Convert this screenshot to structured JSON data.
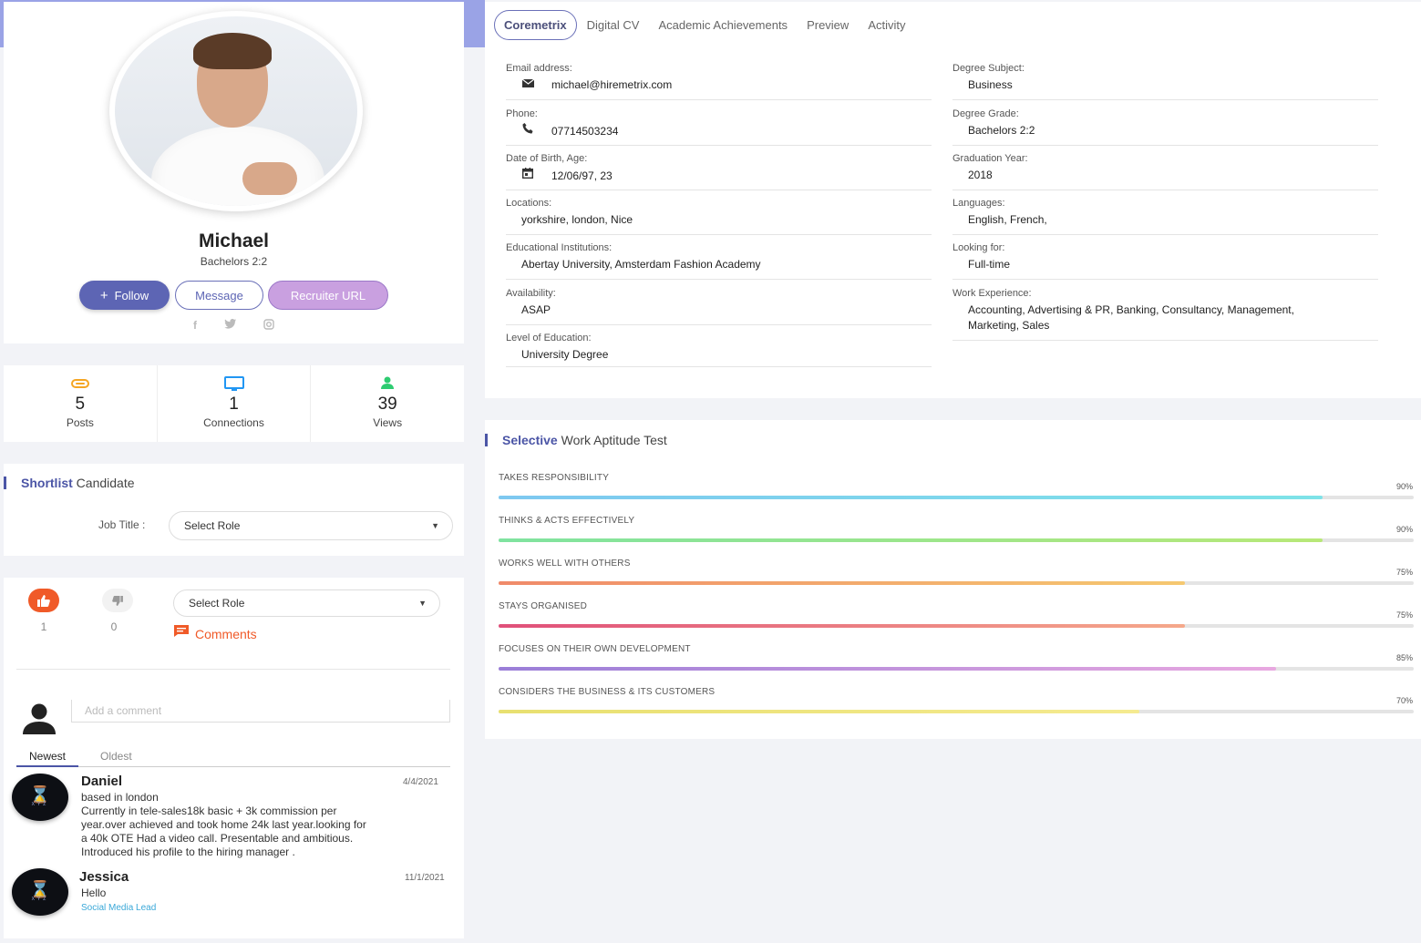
{
  "profile": {
    "name": "Michael",
    "subtitle": "Bachelors 2:2",
    "follow_label": "Follow",
    "message_label": "Message",
    "recruiter_url_label": "Recruiter URL",
    "social_icons": [
      "facebook-icon",
      "twitter-icon",
      "instagram-icon"
    ]
  },
  "stats": [
    {
      "icon": "paperclip-icon",
      "value": "5",
      "label": "Posts",
      "color": "#f5a623"
    },
    {
      "icon": "monitor-icon",
      "value": "1",
      "label": "Connections",
      "color": "#2196f3"
    },
    {
      "icon": "person-icon",
      "value": "39",
      "label": "Views",
      "color": "#2ecc71"
    }
  ],
  "shortlist": {
    "title_bold": "Shortlist",
    "title_rest": "Candidate",
    "job_title_label": "Job Title :",
    "role_select": "Select Role"
  },
  "feedback": {
    "likes": "1",
    "dislikes": "0",
    "role_select": "Select Role",
    "comments_label": "Comments",
    "comment_placeholder": "Add a comment",
    "sort_newest": "Newest",
    "sort_oldest": "Oldest",
    "comments": [
      {
        "author": "Daniel",
        "date": "4/4/2021",
        "lines": [
          "based in london",
          "Currently in tele-sales18k basic + 3k commission per",
          "year.over achieved and took home 24k last year.looking for",
          "a 40k OTE Had a video call. Presentable and ambitious.",
          "Introduced his profile to the hiring manager ."
        ],
        "role": ""
      },
      {
        "author": "Jessica",
        "date": "11/1/2021",
        "lines": [
          "Hello"
        ],
        "role": "Social Media Lead"
      }
    ]
  },
  "tabs": [
    "Coremetrix",
    "Digital CV",
    "Academic Achievements",
    "Preview",
    "Activity"
  ],
  "info_left": [
    {
      "label": "Email address:",
      "value": "michael@hiremetrix.com",
      "icon": "envelope-icon"
    },
    {
      "label": "Phone:",
      "value": "07714503234",
      "icon": "phone-icon"
    },
    {
      "label": "Date of Birth, Age:",
      "value": "12/06/97, 23",
      "icon": "calendar-icon"
    },
    {
      "label": "Locations:",
      "value": "yorkshire, london, Nice",
      "icon": ""
    },
    {
      "label": "Educational Institutions:",
      "value": "Abertay University, Amsterdam Fashion Academy",
      "icon": ""
    },
    {
      "label": "Availability:",
      "value": "ASAP",
      "icon": ""
    },
    {
      "label": "Level of Education:",
      "value": "University Degree",
      "icon": ""
    }
  ],
  "info_right": [
    {
      "label": "Degree Subject:",
      "value": "Business"
    },
    {
      "label": "Degree Grade:",
      "value": "Bachelors 2:2"
    },
    {
      "label": "Graduation Year:",
      "value": "2018"
    },
    {
      "label": "Languages:",
      "value": "English, French,"
    },
    {
      "label": "Looking for:",
      "value": "Full-time"
    },
    {
      "label": "Work Experience:",
      "value": "Accounting, Advertising & PR, Banking, Consultancy, Management, Marketing, Sales"
    }
  ],
  "aptitude": {
    "title_bold": "Selective",
    "title_rest": "Work Aptitude Test",
    "items": [
      {
        "label": "TAKES RESPONSIBILITY",
        "pct_text": "90%",
        "value": 90,
        "from": "#7ec8f0",
        "to": "#7ee3e8"
      },
      {
        "label": "THINKS & ACTS EFFECTIVELY",
        "pct_text": "90%",
        "value": 90,
        "from": "#7fe3a0",
        "to": "#b8e878"
      },
      {
        "label": "WORKS WELL WITH OTHERS",
        "pct_text": "75%",
        "value": 75,
        "from": "#f08a6a",
        "to": "#f5c870"
      },
      {
        "label": "STAYS ORGANISED",
        "pct_text": "75%",
        "value": 75,
        "from": "#e0507a",
        "to": "#f5a88a"
      },
      {
        "label": "FOCUSES ON THEIR OWN DEVELOPMENT",
        "pct_text": "85%",
        "value": 85,
        "from": "#9a7ed8",
        "to": "#e8a8e0"
      },
      {
        "label": "CONSIDERS THE BUSINESS & ITS CUSTOMERS",
        "pct_text": "70%",
        "value": 70,
        "from": "#e8e070",
        "to": "#f5ea90"
      }
    ]
  }
}
